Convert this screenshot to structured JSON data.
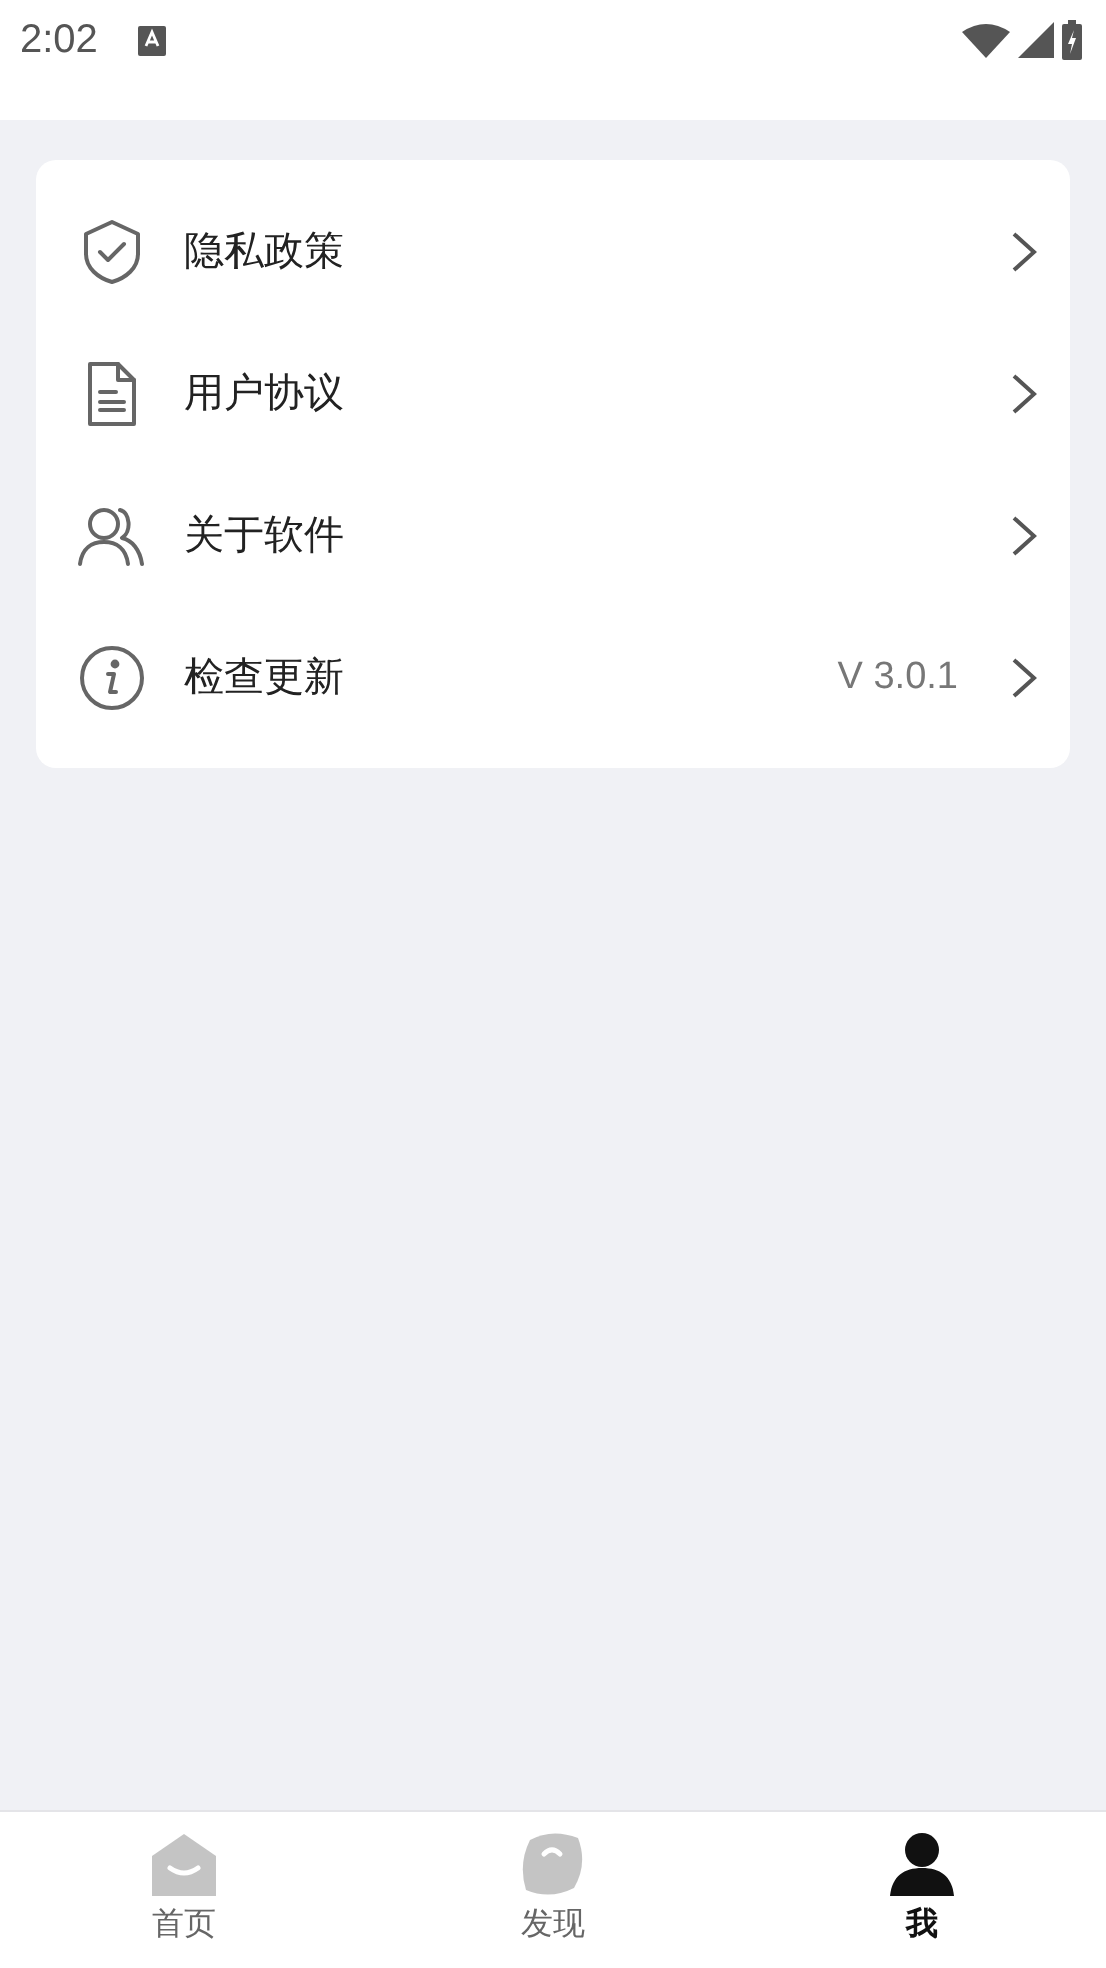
{
  "status_bar": {
    "time": "2:02"
  },
  "menu": [
    {
      "kind": "shield",
      "label": "隐私政策"
    },
    {
      "kind": "document",
      "label": "用户协议"
    },
    {
      "kind": "people",
      "label": "关于软件"
    },
    {
      "kind": "info",
      "label": "检查更新",
      "value": "V 3.0.1"
    }
  ],
  "tab_bar": [
    {
      "kind": "home",
      "label": "首页",
      "selected": false
    },
    {
      "kind": "discover",
      "label": "发现",
      "selected": false
    },
    {
      "kind": "me",
      "label": "我",
      "selected": true
    }
  ]
}
